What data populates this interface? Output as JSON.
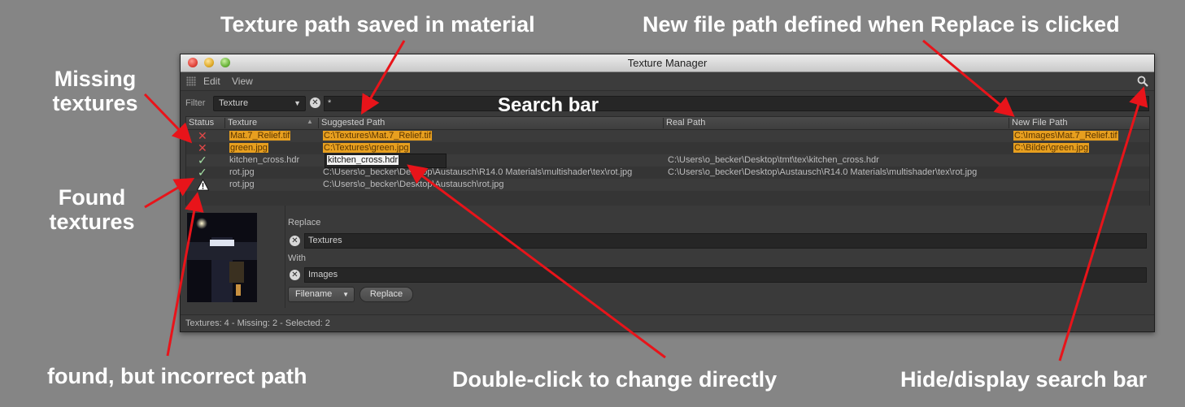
{
  "annotations": {
    "texture_path": "Texture path saved in material",
    "new_file_path": "New file path defined when Replace is clicked",
    "missing": [
      "Missing",
      "textures"
    ],
    "search_bar": "Search bar",
    "found": [
      "Found",
      "textures"
    ],
    "incorrect_path": "found, but incorrect path",
    "double_click": "Double-click to change directly",
    "hide_display": "Hide/display search bar"
  },
  "window": {
    "title": "Texture Manager",
    "menu": [
      "Edit",
      "View"
    ],
    "toolbar_icons": [
      "grip-icon",
      "search-icon"
    ]
  },
  "filter": {
    "label": "Filter",
    "selected": "Texture",
    "query": "*"
  },
  "table": {
    "columns": [
      "Status",
      "Texture",
      "Suggested Path",
      "Real Path",
      "New File Path"
    ],
    "rows": [
      {
        "status": "missing",
        "status_icon": "cross-icon",
        "texture": "Mat.7_Relief.tif",
        "suggested": "C:\\Textures\\Mat.7_Relief.tif",
        "real": "",
        "new_path": "C:\\Images\\Mat.7_Relief.tif"
      },
      {
        "status": "missing",
        "status_icon": "cross-icon",
        "texture": "green.jpg",
        "suggested": "C:\\Textures\\green.jpg",
        "real": "",
        "new_path": "C:\\Bilder\\green.jpg"
      },
      {
        "status": "found",
        "status_icon": "check-icon",
        "texture": "kitchen_cross.hdr",
        "suggested": "kitchen_cross.hdr",
        "real": "C:\\Users\\o_becker\\Desktop\\tmt\\tex\\kitchen_cross.hdr",
        "new_path": ""
      },
      {
        "status": "found",
        "status_icon": "check-icon",
        "texture": "rot.jpg",
        "suggested": "C:\\Users\\o_becker\\Desktop\\Austausch\\R14.0 Materials\\multishader\\tex\\rot.jpg",
        "real": "C:\\Users\\o_becker\\Desktop\\Austausch\\R14.0 Materials\\multishader\\tex\\rot.jpg",
        "new_path": ""
      },
      {
        "status": "warning",
        "status_icon": "warning-icon",
        "texture": "rot.jpg",
        "suggested": "C:\\Users\\o_becker\\Desktop\\Austausch\\rot.jpg",
        "real": "",
        "new_path": ""
      }
    ]
  },
  "replace": {
    "replace_label": "Replace",
    "replace_value": "Textures",
    "with_label": "With",
    "with_value": "Images",
    "mode": "Filename",
    "button": "Replace"
  },
  "status_bar": "Textures: 4  - Missing: 2 - Selected: 2",
  "colors": {
    "highlight": "#e79f1f",
    "missing": "#e04848",
    "found": "#a6e2a6",
    "arrow": "#e8141a"
  }
}
